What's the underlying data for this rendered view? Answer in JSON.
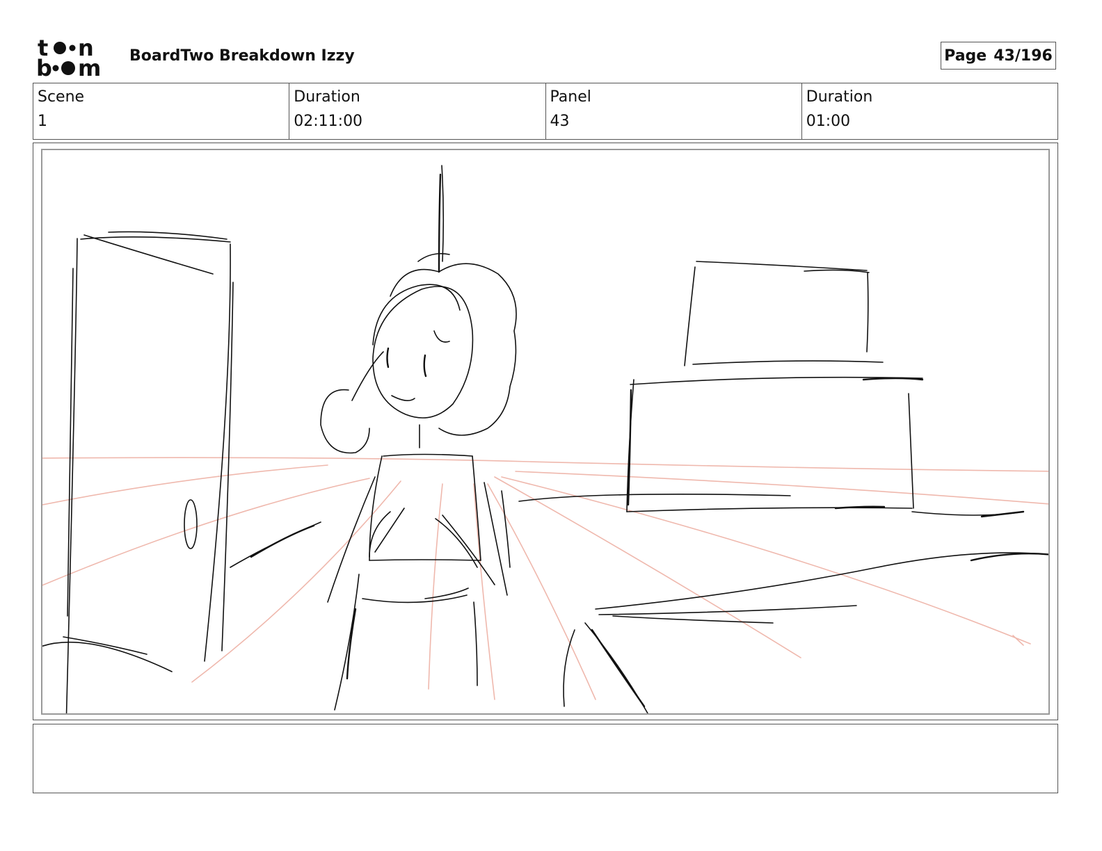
{
  "header": {
    "logo_text": "toonboom",
    "title": "BoardTwo Breakdown Izzy",
    "page_label": "Page",
    "page_value": "43/196"
  },
  "info": {
    "scene_label": "Scene",
    "scene_value": "1",
    "duration_label": "Duration",
    "duration_value": "02:11:00",
    "panel_label": "Panel",
    "panel_value": "43",
    "panel_duration_label": "Duration",
    "panel_duration_value": "01:00"
  },
  "panel_image": {
    "icon": "storyboard-sketch",
    "ink_color": "#111111",
    "perspective_line_color": "#efb8ad"
  },
  "notes": {
    "text": ""
  }
}
